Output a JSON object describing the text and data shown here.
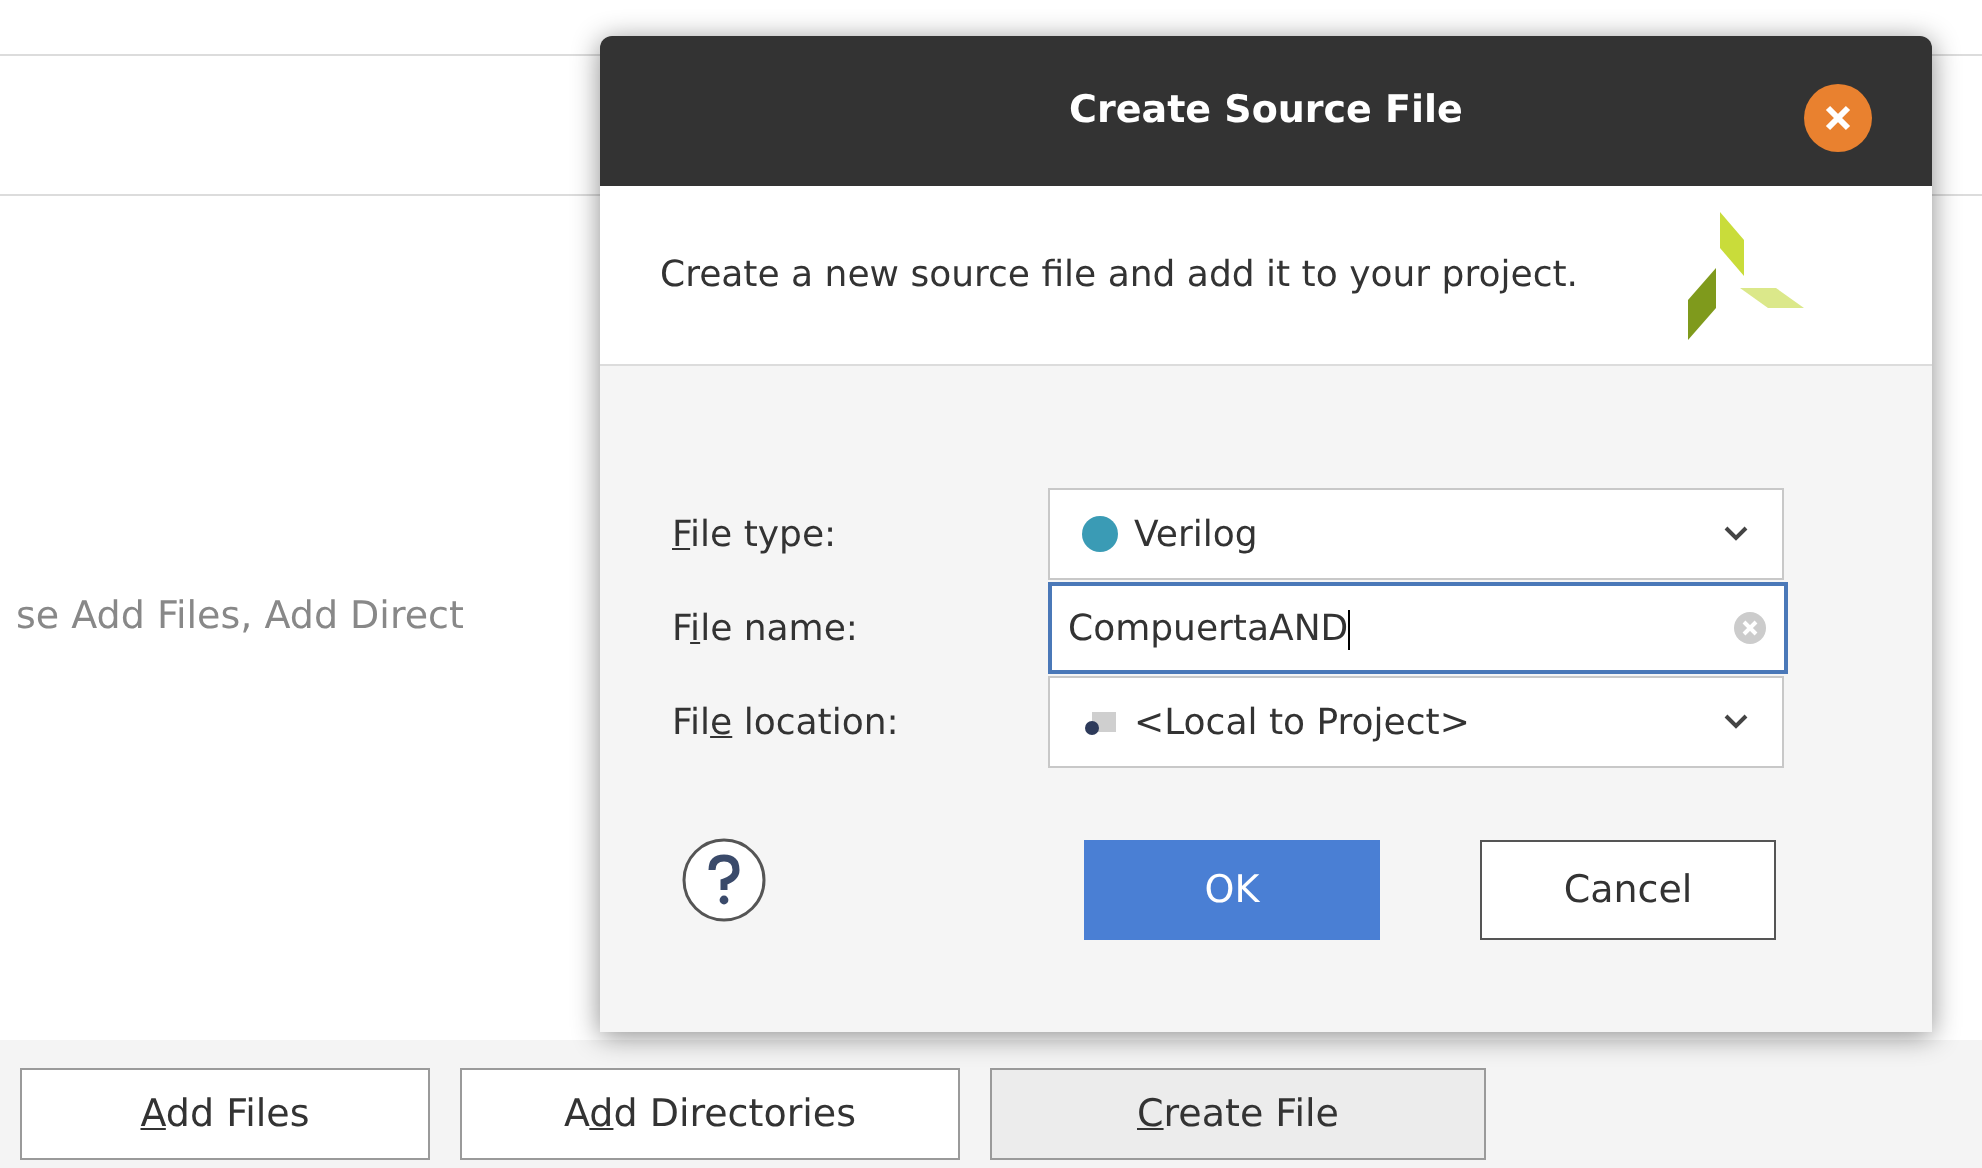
{
  "background": {
    "hint": "se Add Files, Add Direct",
    "buttons": [
      {
        "mnemonic": "A",
        "after": "dd Files",
        "selected": false
      },
      {
        "before": "A",
        "mnemonic": "d",
        "after": "d Directories",
        "selected": false
      },
      {
        "mnemonic": "C",
        "after": "reate File",
        "selected": true
      }
    ]
  },
  "dialog": {
    "title": "Create Source File",
    "description": "Create a new source file and add it to your project.",
    "fields": [
      {
        "kind": "language",
        "label": {
          "mnemonic": "F",
          "after": "ile type:"
        },
        "value": "Verilog",
        "color": "#3a9bb5"
      },
      {
        "kind": "text",
        "label": {
          "before": "F",
          "mnemonic": "i",
          "after": "le name:"
        },
        "value": "CompuertaAND",
        "focused": true
      },
      {
        "kind": "location",
        "label": {
          "before": "Fil",
          "mnemonic": "e",
          "after": " location:"
        },
        "value": "<Local to Project>"
      }
    ],
    "buttons": [
      {
        "label": "OK",
        "primary": true
      },
      {
        "label": "Cancel",
        "primary": false
      }
    ]
  }
}
